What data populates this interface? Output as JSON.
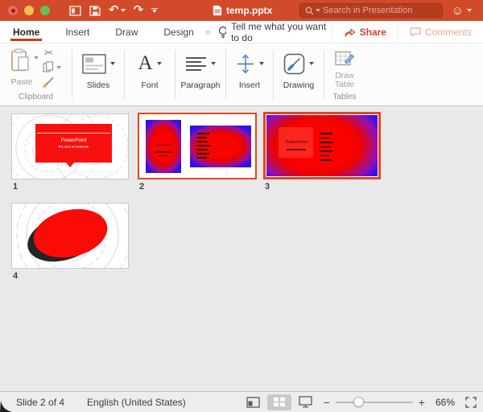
{
  "titlebar": {
    "title": "temp.pptx",
    "search_placeholder": "Search in Presentation"
  },
  "tabs": {
    "home": "Home",
    "insert": "Insert",
    "draw": "Draw",
    "design": "Design",
    "overflow": "»",
    "tell_me": "Tell me what you want to do",
    "share": "Share",
    "comments": "Comments"
  },
  "ribbon": {
    "paste": "Paste",
    "clipboard_group": "Clipboard",
    "slides": "Slides",
    "font_glyph": "A",
    "font": "Font",
    "paragraph": "Paragraph",
    "insert": "Insert",
    "drawing": "Drawing",
    "draw_table": "Draw Table",
    "tables_group": "Tables"
  },
  "slides": [
    {
      "number": "1",
      "title": "PowerPoint",
      "subtitle": "The core of elements"
    },
    {
      "number": "2",
      "card_title": "PowerPoint"
    },
    {
      "number": "3",
      "title": "PowerPoint"
    },
    {
      "number": "4"
    }
  ],
  "statusbar": {
    "slide_info": "Slide 2 of 4",
    "language": "English (United States)",
    "zoom_minus": "−",
    "zoom_plus": "+",
    "zoom_level": "66%"
  },
  "colors": {
    "titlebar_red": "#d14a2a",
    "search_field_red": "#b23d1f",
    "tab_underline_red": "#c23f20",
    "selection_border": "#e8441f",
    "slide_red": "#f8100e",
    "blob_blue": "#3511e6"
  }
}
